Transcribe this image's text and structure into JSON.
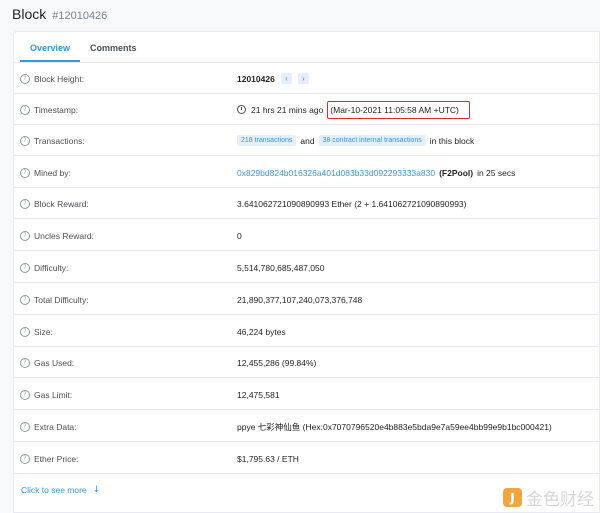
{
  "header": {
    "title": "Block",
    "block_id": "#12010426"
  },
  "tabs": [
    {
      "label": "Overview",
      "active": true
    },
    {
      "label": "Comments",
      "active": false
    }
  ],
  "rows": {
    "block_height": {
      "label": "Block Height:",
      "value": "12010426"
    },
    "timestamp": {
      "label": "Timestamp:",
      "relative": "21 hrs 21 mins ago",
      "absolute": "(Mar-10-2021 11:05:58 AM +UTC)"
    },
    "transactions": {
      "label": "Transactions:",
      "tx_badge": "218 transactions",
      "and": "and",
      "internal_badge": "38 contract internal transactions",
      "suffix": "in this block"
    },
    "mined_by": {
      "label": "Mined by:",
      "address": "0x829bd824b016326a401d083b33d092293333a830",
      "pool": "(F2Pool)",
      "suffix": "in 25 secs"
    },
    "block_reward": {
      "label": "Block Reward:",
      "value": "3.641062721090890993 Ether (2 + 1.641062721090890993)"
    },
    "uncles_reward": {
      "label": "Uncles Reward:",
      "value": "0"
    },
    "difficulty": {
      "label": "Difficulty:",
      "value": "5,514,780,685,487,050"
    },
    "total_difficulty": {
      "label": "Total Difficulty:",
      "value": "21,890,377,107,240,073,376,748"
    },
    "size": {
      "label": "Size:",
      "value": "46,224 bytes"
    },
    "gas_used": {
      "label": "Gas Used:",
      "value": "12,455,286 (99.84%)"
    },
    "gas_limit": {
      "label": "Gas Limit:",
      "value": "12,475,581"
    },
    "extra_data": {
      "label": "Extra Data:",
      "value": "ppye 七彩神仙鱼 (Hex:0x7070796520e4b883e5bda9e7a59ee4bb99e9b1bc000421)"
    },
    "ether_price": {
      "label": "Ether Price:",
      "value": "$1,795.63 / ETH"
    }
  },
  "footer": {
    "more_label": "Click to see more"
  },
  "watermark": {
    "text": "金色财经"
  },
  "colors": {
    "accent": "#3498db",
    "highlight_box": "#d93025",
    "watermark_logo": "#f0a640"
  }
}
